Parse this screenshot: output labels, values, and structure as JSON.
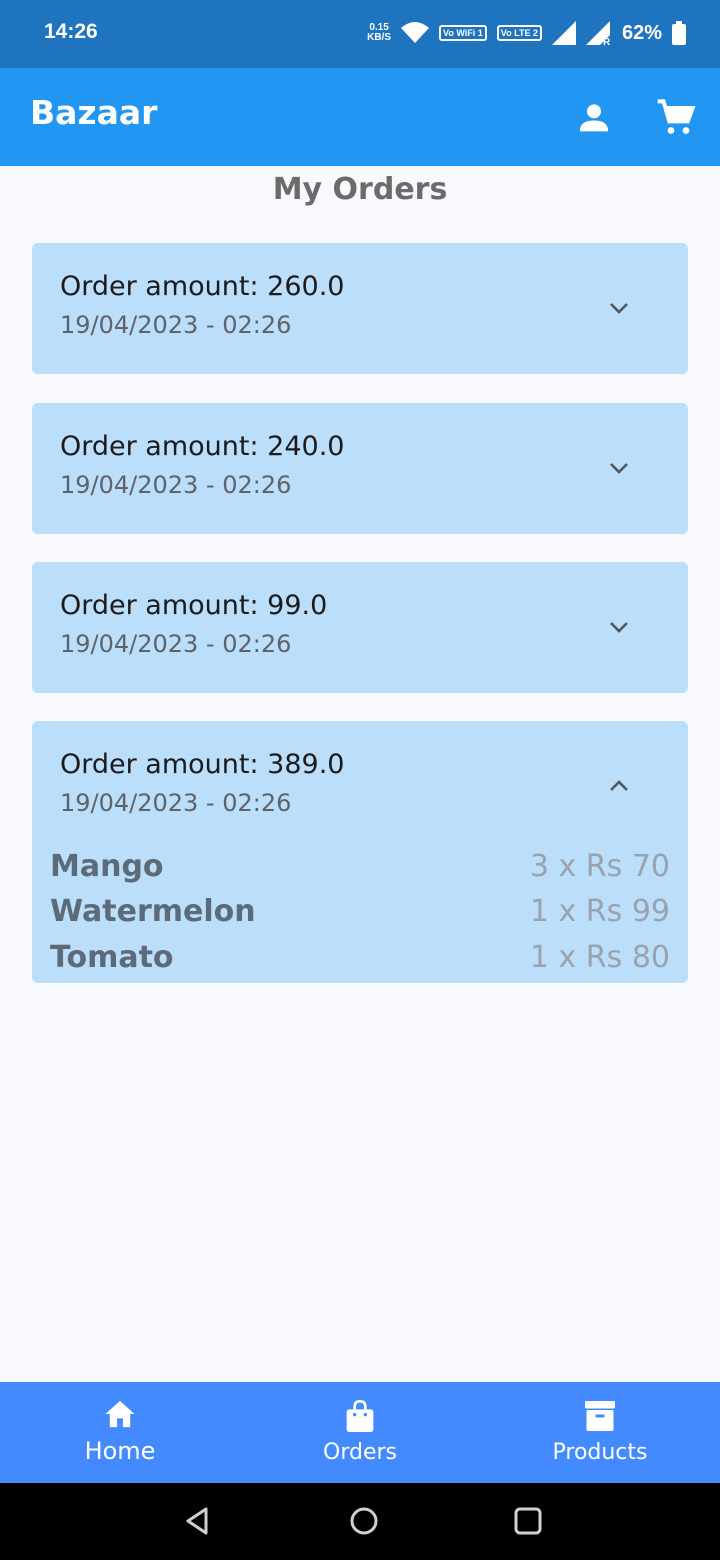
{
  "status_bar": {
    "time": "14:26",
    "net_speed_value": "0.15",
    "net_speed_unit": "KB/S",
    "volte_wifi": "Vo WiFi 1",
    "volte_lte": "Vo LTE 2",
    "battery": "62%"
  },
  "app_bar": {
    "title": "Bazaar",
    "icons": [
      "account-icon",
      "cart-icon"
    ]
  },
  "page": {
    "title": "My Orders"
  },
  "orders": [
    {
      "amount_label": "Order amount: 260.0",
      "date": "19/04/2023 - 02:26",
      "expanded": false
    },
    {
      "amount_label": "Order amount: 240.0",
      "date": "19/04/2023 - 02:26",
      "expanded": false
    },
    {
      "amount_label": "Order amount: 99.0",
      "date": "19/04/2023 - 02:26",
      "expanded": false
    },
    {
      "amount_label": "Order amount: 389.0",
      "date": "19/04/2023 - 02:26",
      "expanded": true,
      "items": [
        {
          "name": "Mango",
          "qty_price": "3 x Rs 70"
        },
        {
          "name": "Watermelon",
          "qty_price": "1 x Rs 99"
        },
        {
          "name": "Tomato",
          "qty_price": "1 x Rs 80"
        }
      ]
    }
  ],
  "bottom_nav": {
    "items": [
      {
        "label": "Home",
        "icon": "home-icon",
        "active": true
      },
      {
        "label": "Orders",
        "icon": "shopping-bag-icon",
        "active": false
      },
      {
        "label": "Products",
        "icon": "archive-box-icon",
        "active": false
      }
    ]
  },
  "colors": {
    "status_bar": "#1f74c0",
    "app_bar": "#2196f3",
    "card": "#bbdefb",
    "bottom_nav": "#448aff"
  }
}
